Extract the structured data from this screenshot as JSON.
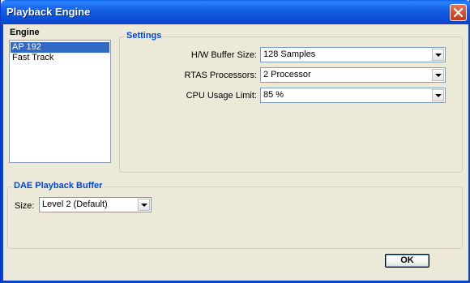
{
  "window": {
    "title": "Playback Engine"
  },
  "engine": {
    "label": "Engine",
    "items": [
      "AP 192",
      "Fast Track"
    ],
    "selected_index": 0
  },
  "settings": {
    "title": "Settings",
    "hw_buffer": {
      "label": "H/W Buffer Size:",
      "value": "128 Samples"
    },
    "rtas": {
      "label": "RTAS Processors:",
      "value": "2 Processor"
    },
    "cpu": {
      "label": "CPU Usage Limit:",
      "value": "85 %"
    }
  },
  "dae": {
    "title": "DAE Playback Buffer",
    "size": {
      "label": "Size:",
      "value": "Level 2 (Default)"
    }
  },
  "buttons": {
    "ok": "OK"
  },
  "colors": {
    "title_bar": "#0a46c2",
    "selection": "#316ac5",
    "group_title": "#0046d5",
    "background": "#ece9d8"
  },
  "icons": {
    "close": "close-icon",
    "dropdown": "chevron-down-icon"
  }
}
